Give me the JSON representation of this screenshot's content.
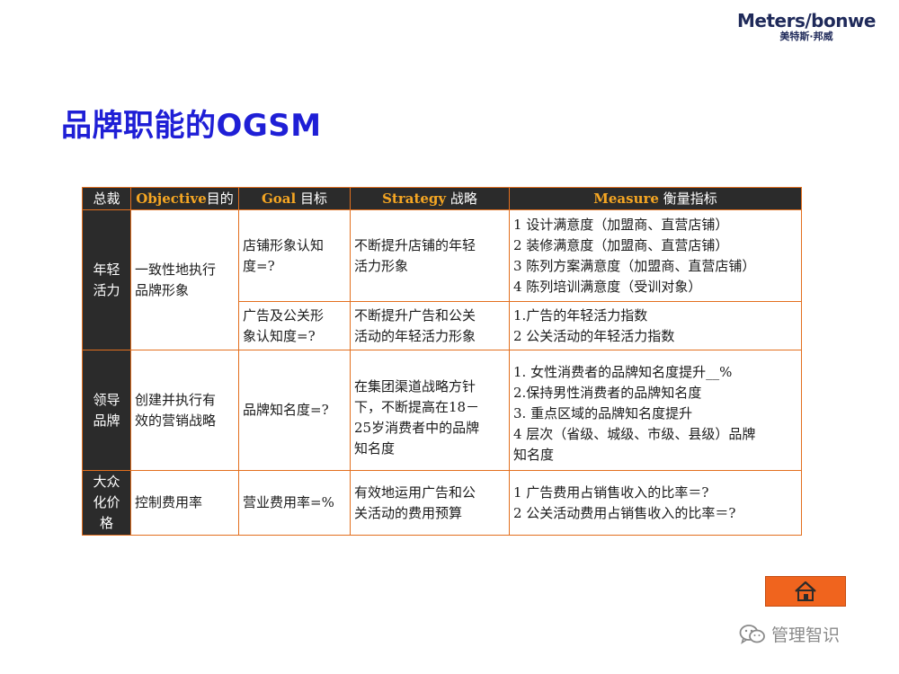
{
  "logo": {
    "brand": "Meters/bonwe",
    "sub": "美特斯·邦威"
  },
  "title": "品牌职能的OGSM",
  "table": {
    "headers": {
      "c0": "总裁",
      "c1_hl": "Objective",
      "c1_rest": "目的",
      "c2_hl": "Goal",
      "c2_rest": " 目标",
      "c3_hl": "Strategy",
      "c3_rest": " 战略",
      "c4_hl": "Measure",
      "c4_rest": " 衡量指标"
    },
    "rows": [
      {
        "category": [
          "年轻",
          "活力"
        ],
        "objective": [
          "一致性地执行",
          "品牌形象"
        ],
        "goals": [
          {
            "goal": [
              "店铺形象认知",
              "度=?"
            ],
            "strategy": [
              "不断提升店铺的年轻",
              "活力形象"
            ],
            "measures": [
              "1 设计满意度（加盟商、直营店铺）",
              "2 装修满意度（加盟商、直营店铺）",
              "3 陈列方案满意度（加盟商、直营店铺）",
              "4 陈列培训满意度（受训对象）"
            ]
          },
          {
            "goal": [
              "广告及公关形",
              "象认知度=?"
            ],
            "strategy": [
              "不断提升广告和公关",
              "活动的年轻活力形象"
            ],
            "measures": [
              "1.广告的年轻活力指数",
              "2 公关活动的年轻活力指数"
            ]
          }
        ]
      },
      {
        "category": [
          "领导",
          "品牌"
        ],
        "objective": [
          "创建并执行有",
          "效的营销战略"
        ],
        "goals": [
          {
            "goal": [
              "品牌知名度=?"
            ],
            "strategy": [
              "在集团渠道战略方针",
              "下，不断提高在18－",
              "25岁消费者中的品牌",
              "知名度"
            ],
            "measures": [
              "1. 女性消费者的品牌知名度提升__%",
              "2.保持男性消费者的品牌知名度",
              "3. 重点区域的品牌知名度提升",
              "4 层次（省级、城级、市级、县级）品牌",
              "知名度"
            ]
          }
        ]
      },
      {
        "category": [
          "大众",
          "化价",
          "格"
        ],
        "objective": [
          "控制费用率"
        ],
        "goals": [
          {
            "goal": [
              "营业费用率=%"
            ],
            "strategy": [
              "有效地运用广告和公",
              "关活动的费用预算"
            ],
            "measures": [
              "1 广告费用占销售收入的比率＝?",
              "2 公关活动费用占销售收入的比率＝?"
            ]
          }
        ]
      }
    ]
  },
  "home_button": {
    "icon": "home-icon"
  },
  "watermark": {
    "icon": "wechat-icon",
    "text": "管理智识"
  },
  "colors": {
    "title": "#1f1fd6",
    "border": "#e36f1e",
    "header_bg": "#2b2b2b",
    "header_highlight": "#f5a623",
    "button": "#f0641e"
  }
}
